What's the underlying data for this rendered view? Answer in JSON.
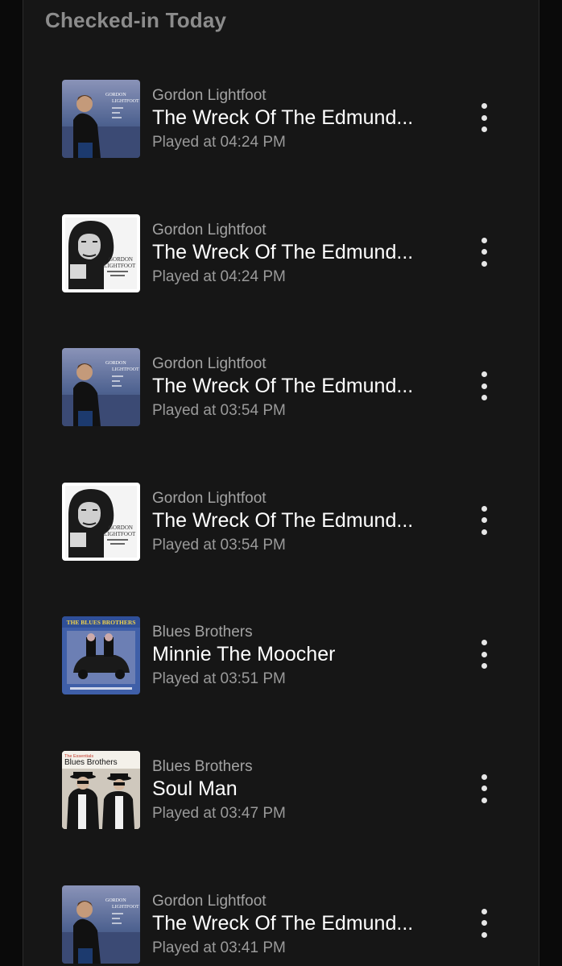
{
  "section": {
    "title": "Checked-in Today"
  },
  "plays": [
    {
      "artist": "Gordon Lightfoot",
      "track": "The Wreck Of The Edmund...",
      "played": "Played at 04:24 PM",
      "art": "gordon-lightfoot-blue"
    },
    {
      "artist": "Gordon Lightfoot",
      "track": "The Wreck Of The Edmund...",
      "played": "Played at 04:24 PM",
      "art": "gordon-lightfoot-bw"
    },
    {
      "artist": "Gordon Lightfoot",
      "track": "The Wreck Of The Edmund...",
      "played": "Played at 03:54 PM",
      "art": "gordon-lightfoot-blue"
    },
    {
      "artist": "Gordon Lightfoot",
      "track": "The Wreck Of The Edmund...",
      "played": "Played at 03:54 PM",
      "art": "gordon-lightfoot-bw"
    },
    {
      "artist": "Blues Brothers",
      "track": "Minnie The Moocher",
      "played": "Played at 03:51 PM",
      "art": "blues-brothers-car"
    },
    {
      "artist": "Blues Brothers",
      "track": "Soul Man",
      "played": "Played at 03:47 PM",
      "art": "blues-brothers-essentials"
    },
    {
      "artist": "Gordon Lightfoot",
      "track": "The Wreck Of The Edmund...",
      "played": "Played at 03:41 PM",
      "art": "gordon-lightfoot-blue"
    }
  ],
  "art_text": {
    "gordon_blue": [
      "GORDON",
      "LIGHTFOOT"
    ],
    "gordon_bw": [
      "GORDON",
      "LIGHTFOOT"
    ],
    "blues_car": "THE BLUES BROTHERS",
    "blues_essentials_small": "The Essentials",
    "blues_essentials": "Blues Brothers"
  },
  "icons": {
    "more": "more-vertical-icon"
  },
  "colors": {
    "background": "#0a0a0a",
    "panel": "#161616",
    "title": "#8c8c8c",
    "track": "#ffffff",
    "meta": "#a3a3a3"
  }
}
